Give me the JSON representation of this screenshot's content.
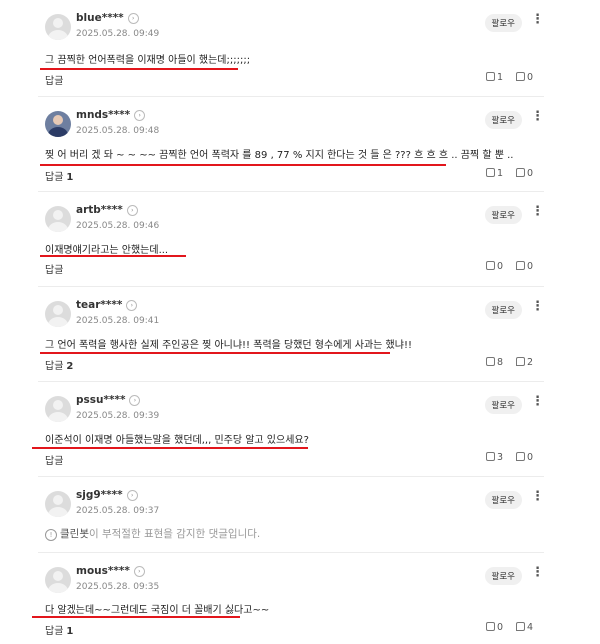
{
  "follow_label": "팔로우",
  "more_glyph": "⋮",
  "reply_label": "답글",
  "comments": [
    {
      "nick": "blue****",
      "date": "2025.05.28. 09:49",
      "text": "그 끔찍한 언어폭력을 이재명 아들이 했는데;;;;;;;",
      "reply_count": "",
      "up": "1",
      "down": "0"
    },
    {
      "nick": "mnds****",
      "date": "2025.05.28. 09:48",
      "text": "찢 어 버리 겠 돠 ~ ~ ~~ 끔찍한 언어 폭력자 를 89 , 77 % 지지 한다는 것 들 은 ??? 흐 흐 흐 .. 끔찍 할 뿐 ..",
      "reply_count": "1",
      "up": "1",
      "down": "0"
    },
    {
      "nick": "artb****",
      "date": "2025.05.28. 09:46",
      "text": "이재명얘기라고는 안했는데...",
      "reply_count": "",
      "up": "0",
      "down": "0"
    },
    {
      "nick": "tear****",
      "date": "2025.05.28. 09:41",
      "text": "그 언어 폭력을 행사한 실제 주인공은 찢 아니냐!! 폭력을 당했던 형수에게 사과는 했냐!!",
      "reply_count": "2",
      "up": "8",
      "down": "2"
    },
    {
      "nick": "pssu****",
      "date": "2025.05.28. 09:39",
      "text": "이준석이 이재명 아들했는말을 했던데,,, 민주당 알고 있으세요?",
      "reply_count": "",
      "up": "3",
      "down": "0"
    },
    {
      "nick": "sjg9****",
      "date": "2025.05.28. 09:37",
      "cleanbot_prefix": "클린봇",
      "cleanbot_text": "이 부적절한 표현을 감지한 댓글입니다."
    },
    {
      "nick": "mous****",
      "date": "2025.05.28. 09:35",
      "text": "다 알겠는데~~그런데도 국짐이 더 꼴배기 싫다고~~",
      "reply_count": "1",
      "up": "0",
      "down": "4"
    }
  ]
}
